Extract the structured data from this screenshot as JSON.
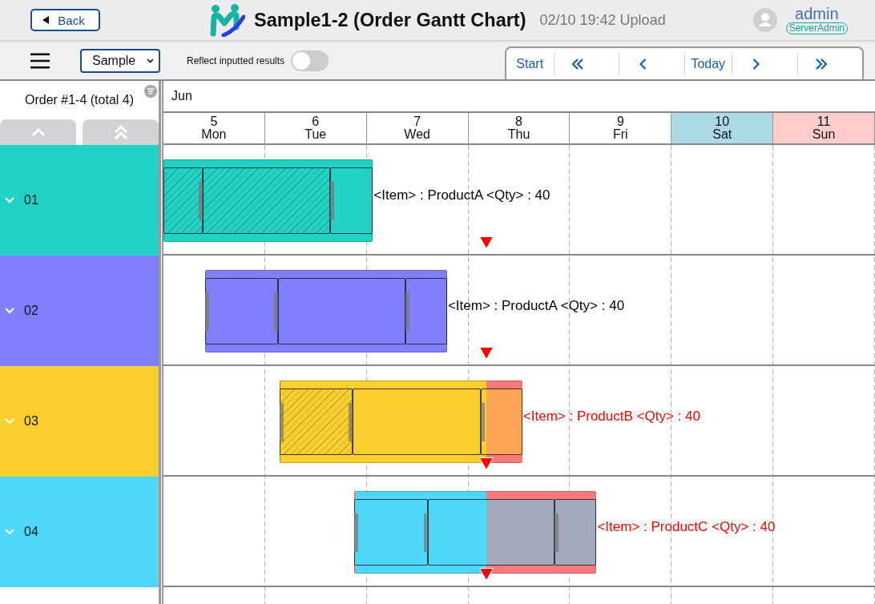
{
  "header": {
    "back_button": "Back",
    "title": "Sample1-2 (Order Gantt Chart)",
    "upload_info": "02/10 19:42 Upload",
    "user": {
      "name": "admin",
      "role": "ServerAdmin"
    }
  },
  "toolbar": {
    "view_select": {
      "value": "Sample"
    },
    "reflect_toggle": {
      "label": "Reflect inputted results",
      "on": false
    },
    "navigation": [
      {
        "kind": "text",
        "label": "Start"
      },
      {
        "kind": "double-left"
      },
      {
        "kind": "left"
      },
      {
        "kind": "text",
        "label": "Today"
      },
      {
        "kind": "right"
      },
      {
        "kind": "double-right"
      }
    ]
  },
  "order_panel": {
    "title": "Order #1-4 (total 4)"
  },
  "timeline": {
    "month": "Jun",
    "days": [
      {
        "date": "5",
        "weekday": "Mon",
        "kind": "weekday"
      },
      {
        "date": "6",
        "weekday": "Tue",
        "kind": "weekday"
      },
      {
        "date": "7",
        "weekday": "Wed",
        "kind": "weekday"
      },
      {
        "date": "8",
        "weekday": "Thu",
        "kind": "weekday"
      },
      {
        "date": "9",
        "weekday": "Fri",
        "kind": "weekday"
      },
      {
        "date": "10",
        "weekday": "Sat",
        "kind": "saturday"
      },
      {
        "date": "11",
        "weekday": "Sun",
        "kind": "sunday"
      }
    ]
  },
  "orders": [
    {
      "label": "01",
      "color": "#22d3c5",
      "overdue": false,
      "caption": "<Item> : ProductA <Qty> : 40",
      "segments": [
        {
          "hatched": true
        },
        {
          "hatched": true
        },
        {
          "hatched": false
        }
      ]
    },
    {
      "label": "02",
      "color": "#8080ff",
      "overdue": false,
      "caption": "<Item> : ProductA <Qty> : 40",
      "segments": [
        {
          "hatched": false
        },
        {
          "hatched": false
        },
        {
          "hatched": false
        }
      ]
    },
    {
      "label": "03",
      "color": "#fbcf2f",
      "overdue": true,
      "caption": "<Item> : ProductB <Qty> : 40",
      "segments": [
        {
          "hatched": true
        },
        {
          "hatched": false
        },
        {
          "hatched": false
        }
      ]
    },
    {
      "label": "04",
      "color": "#4dd8fa",
      "overdue": true,
      "caption": "<Item> : ProductC <Qty> : 40",
      "segments": [
        {
          "hatched": false
        },
        {
          "hatched": false
        },
        {
          "hatched": false
        }
      ]
    }
  ]
}
